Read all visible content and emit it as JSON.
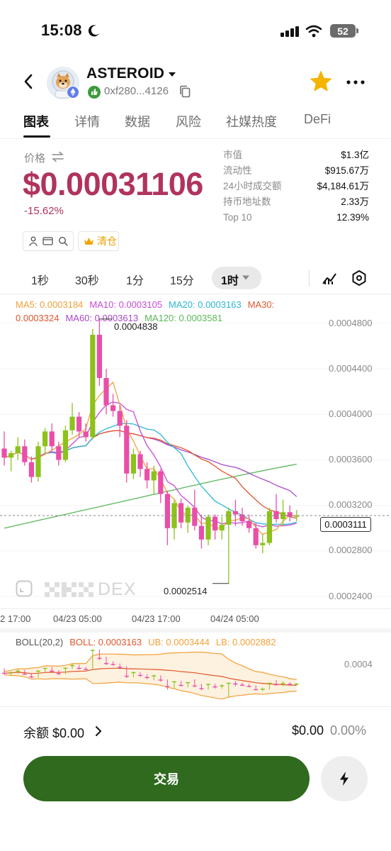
{
  "status_bar": {
    "time": "15:08",
    "battery": "52"
  },
  "header": {
    "token_name": "ASTEROID",
    "address": "0xf280...4126"
  },
  "tabs": [
    {
      "label": "图表"
    },
    {
      "label": "详情"
    },
    {
      "label": "数据"
    },
    {
      "label": "风险"
    },
    {
      "label": "社媒热度"
    },
    {
      "label": "DeFi"
    }
  ],
  "price": {
    "label": "价格",
    "value": "$0.00031106",
    "change": "-15.62%"
  },
  "stats": [
    {
      "label": "市值",
      "value": "$1.3亿"
    },
    {
      "label": "流动性",
      "value": "$915.67万"
    },
    {
      "label": "24小时成交额",
      "value": "$4,184.61万"
    },
    {
      "label": "持币地址数",
      "value": "2.33万"
    },
    {
      "label": "Top 10",
      "value": "12.39%"
    }
  ],
  "tools": {
    "clear_label": "清仓"
  },
  "timeframes": [
    {
      "label": "1秒"
    },
    {
      "label": "30秒"
    },
    {
      "label": "1分"
    },
    {
      "label": "15分"
    },
    {
      "label": "1时"
    }
  ],
  "ma_legend": {
    "ma5": "MA5: 0.0003184",
    "ma10": "MA10: 0.0003105",
    "ma20": "MA20: 0.0003163",
    "ma30": "MA30:",
    "ma30_value": "0.0003324",
    "ma60": "MA60: 0.0003613",
    "ma120": "MA120: 0.0003581"
  },
  "colors": {
    "up": "#8cc21a",
    "down": "#ea4ea8",
    "ma5": "#f2a13a",
    "ma10": "#c74ad8",
    "ma20": "#2bb7d6",
    "ma30": "#e0562d",
    "ma60": "#a948c9",
    "ma120": "#5ab85a",
    "price": "#b0335e",
    "accent_button": "#2f6a1f"
  },
  "chart_data": {
    "type": "candlestick",
    "ylim": [
      0.00023,
      0.0005
    ],
    "price_ticks": [
      "0.0004800",
      "0.0004400",
      "0.0004000",
      "0.0003600",
      "0.0003200",
      "0.0002800",
      "0.0002400"
    ],
    "time_ticks": [
      "2 17:00",
      "04/23 05:00",
      "04/23 17:00",
      "04/24 05:00"
    ],
    "current_price": "0.0003111",
    "high_label": "0.0004838",
    "low_label": "0.0002514",
    "candles": [
      [
        0.00037,
        0.000385,
        0.000355,
        0.000362
      ],
      [
        0.000362,
        0.000368,
        0.00035,
        0.000366
      ],
      [
        0.000366,
        0.00038,
        0.00036,
        0.000372
      ],
      [
        0.000372,
        0.000378,
        0.000355,
        0.000358
      ],
      [
        0.000358,
        0.000363,
        0.00034,
        0.000345
      ],
      [
        0.000345,
        0.000376,
        0.000341,
        0.000372
      ],
      [
        0.000372,
        0.000388,
        0.000365,
        0.000385
      ],
      [
        0.000385,
        0.000392,
        0.000368,
        0.000372
      ],
      [
        0.000372,
        0.000376,
        0.000355,
        0.00036
      ],
      [
        0.00036,
        0.00039,
        0.000358,
        0.000386
      ],
      [
        0.000386,
        0.00041,
        0.000382,
        0.000398
      ],
      [
        0.000398,
        0.000402,
        0.00038,
        0.000385
      ],
      [
        0.000385,
        0.000392,
        0.000376,
        0.00038
      ],
      [
        0.00038,
        0.000475,
        0.000378,
        0.00047
      ],
      [
        0.00047,
        0.000484,
        0.000425,
        0.000432
      ],
      [
        0.000432,
        0.00044,
        0.0004,
        0.000408
      ],
      [
        0.000408,
        0.000418,
        0.000398,
        0.000403
      ],
      [
        0.000403,
        0.000408,
        0.00038,
        0.00039
      ],
      [
        0.00039,
        0.000395,
        0.00034,
        0.000348
      ],
      [
        0.000348,
        0.00037,
        0.000343,
        0.000365
      ],
      [
        0.000365,
        0.000368,
        0.000345,
        0.000352
      ],
      [
        0.000352,
        0.000358,
        0.000335,
        0.000342
      ],
      [
        0.000342,
        0.000355,
        0.00033,
        0.00035
      ],
      [
        0.00035,
        0.000352,
        0.000322,
        0.00033
      ],
      [
        0.00033,
        0.000333,
        0.000285,
        0.0003
      ],
      [
        0.0003,
        0.000325,
        0.00029,
        0.000322
      ],
      [
        0.000322,
        0.000326,
        0.0003,
        0.000305
      ],
      [
        0.000305,
        0.00032,
        0.000296,
        0.000318
      ],
      [
        0.000318,
        0.000334,
        0.000298,
        0.000302
      ],
      [
        0.000302,
        0.000312,
        0.000282,
        0.00029
      ],
      [
        0.00029,
        0.000312,
        0.000285,
        0.00031
      ],
      [
        0.00031,
        0.000312,
        0.00029,
        0.000298
      ],
      [
        0.000298,
        0.00031,
        0.00029,
        0.000303
      ],
      [
        0.000303,
        0.000318,
        0.000251,
        0.000315
      ],
      [
        0.000315,
        0.000325,
        0.000302,
        0.000312
      ],
      [
        0.000312,
        0.000318,
        0.000302,
        0.000306
      ],
      [
        0.000306,
        0.000312,
        0.000296,
        0.0003
      ],
      [
        0.0003,
        0.000305,
        0.000282,
        0.000285
      ],
      [
        0.000285,
        0.000295,
        0.000278,
        0.000287
      ],
      [
        0.000287,
        0.000318,
        0.000285,
        0.000315
      ],
      [
        0.000315,
        0.00033,
        0.000305,
        0.000308
      ],
      [
        0.000308,
        0.000325,
        0.000302,
        0.000314
      ],
      [
        0.000314,
        0.00032,
        0.000306,
        0.00031
      ],
      [
        0.00031,
        0.000316,
        0.000306,
        0.000311
      ]
    ]
  },
  "boll": {
    "title": "BOLL(20,2)",
    "boll": "BOLL: 0.0003163",
    "ub": "UB: 0.0003444",
    "lb": "LB: 0.0002882",
    "axis_label": "0.0004"
  },
  "bottom": {
    "balance_label": "余额 $0.00",
    "balance_value": "$0.00",
    "balance_pct": "0.00%",
    "trade_label": "交易"
  }
}
